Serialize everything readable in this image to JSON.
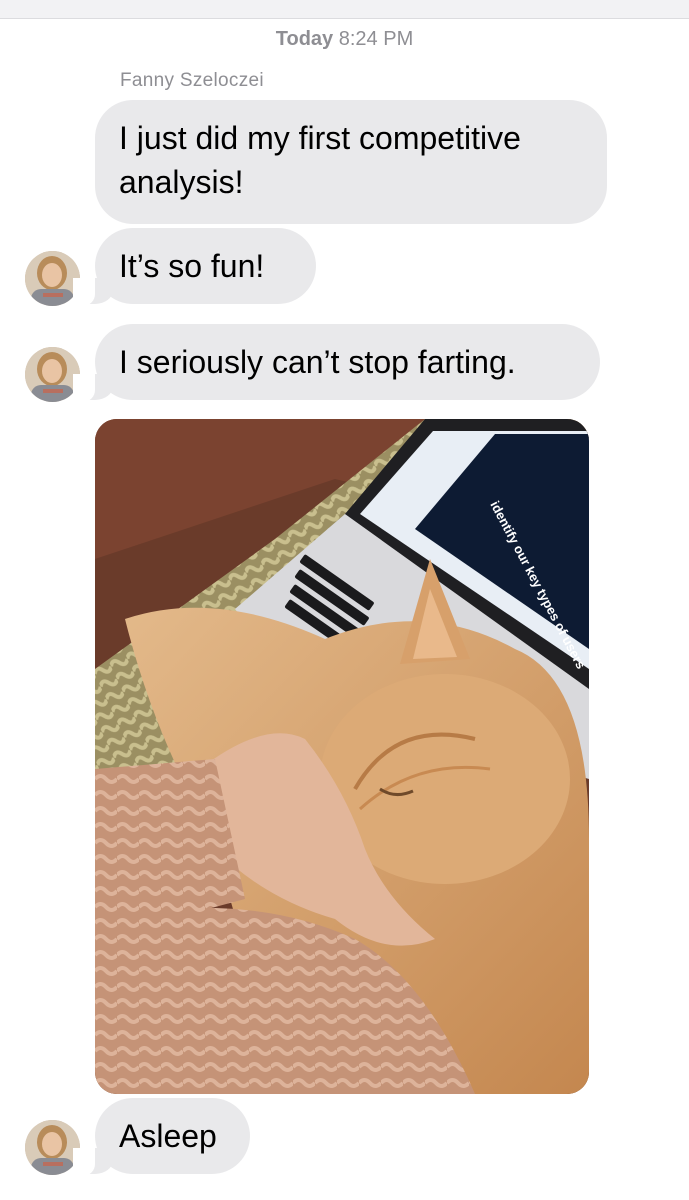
{
  "header": {
    "day": "Today",
    "time": "8:24 PM"
  },
  "sender": {
    "name": "Fanny Szeloczei"
  },
  "messages": [
    {
      "text": "I just did my first competitive analysis!"
    },
    {
      "text": "It’s so fun!"
    },
    {
      "text": "I seriously can’t stop farting."
    },
    {
      "text": "Asleep"
    }
  ],
  "photo": {
    "screen_heading": "identify our key types of users"
  },
  "colors": {
    "bubble": "#e9e9eb",
    "timestamp": "#8e8e93",
    "background": "#ffffff"
  },
  "icons": {
    "avatar": "person-avatar"
  }
}
